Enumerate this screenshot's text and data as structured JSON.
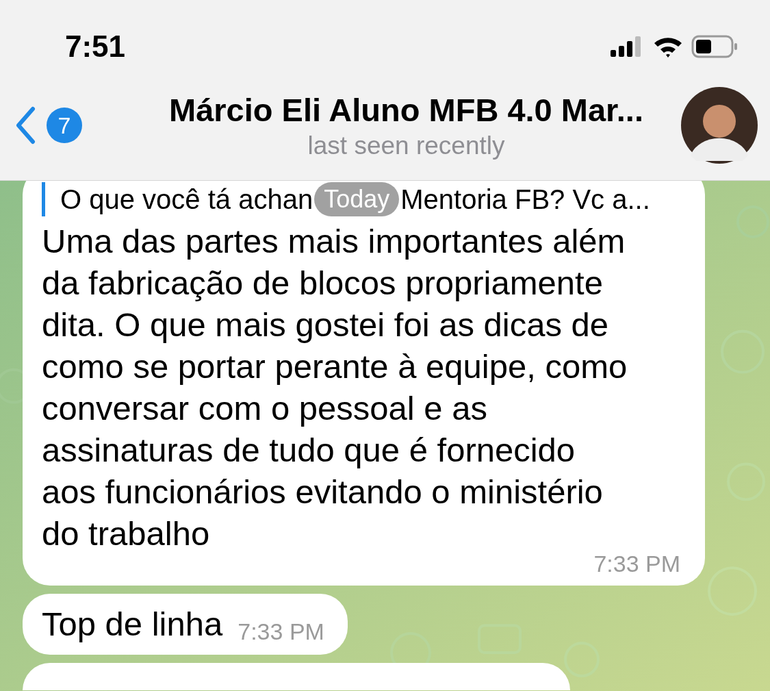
{
  "status_bar": {
    "time": "7:51"
  },
  "header": {
    "back_badge": "7",
    "title": "Márcio Eli Aluno MFB 4.0 Mar...",
    "subtitle": "last seen recently"
  },
  "date_pill": "Today",
  "messages": [
    {
      "kind": "reply",
      "quote_before": "O que você tá achan",
      "quote_after": "Mentoria FB? Vc a...",
      "text": "Uma das partes mais importantes além da fabricação de blocos propriamente dita. O que mais gostei foi as dicas de como se portar perante à equipe, como conversar com o pessoal e as assinaturas de tudo que é fornecido aos funcionários evitando o ministério do trabalho",
      "time": "7:33 PM"
    },
    {
      "kind": "short",
      "text": "Top de linha",
      "time": "7:33 PM"
    }
  ]
}
